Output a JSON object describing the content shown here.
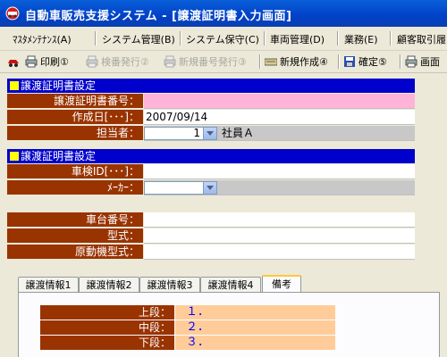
{
  "window": {
    "title": "自動車販売支援システム - [譲渡証明書入力画面]"
  },
  "menu": [
    {
      "label": "ﾏｽﾀﾒﾝﾃﾅﾝｽ(A)"
    },
    {
      "label": "システム管理(B)"
    },
    {
      "label": "システム保守(C)"
    },
    {
      "label": "車両管理(D)"
    },
    {
      "label": "業務(E)"
    },
    {
      "label": "顧客取引履"
    }
  ],
  "toolbar": {
    "print": "印刷①",
    "inspection_issue": "検番発行②",
    "new_number_issue": "新規番号発行③",
    "new_create": "新規作成④",
    "confirm": "確定⑤",
    "screen": "画面"
  },
  "section1": {
    "header": "譲渡証明書設定",
    "cert_number_label": "譲渡証明書番号：",
    "cert_number_value": "",
    "created_date_label": "作成日[･･･]：",
    "created_date_value": "2007/09/14",
    "staff_label": "担当者：",
    "staff_code": "1",
    "staff_name": "社員Ａ"
  },
  "section2": {
    "header": "譲渡証明書設定",
    "vehicle_id_label": "車検ID[･･･]：",
    "vehicle_id_value": "",
    "maker_label": "ﾒｰｶｰ：",
    "maker_value": ""
  },
  "section3": {
    "chassis_label": "車台番号：",
    "chassis_value": "",
    "model_label": "型式：",
    "model_value": "",
    "engine_label": "原動機型式：",
    "engine_value": ""
  },
  "tabs": [
    {
      "label": "譲渡情報1"
    },
    {
      "label": "譲渡情報2"
    },
    {
      "label": "譲渡情報3"
    },
    {
      "label": "譲渡情報4"
    },
    {
      "label": "備考"
    }
  ],
  "notes": {
    "upper_label": "上段：",
    "upper_value": "１．",
    "middle_label": "中段：",
    "middle_value": "２．",
    "lower_label": "下段：",
    "lower_value": "３．"
  },
  "colors": {
    "label_bg": "#993300",
    "section_header_bg": "#0000cc",
    "required_field_bg": "#ffb3d9",
    "notes_value_bg": "#ffcc99"
  }
}
